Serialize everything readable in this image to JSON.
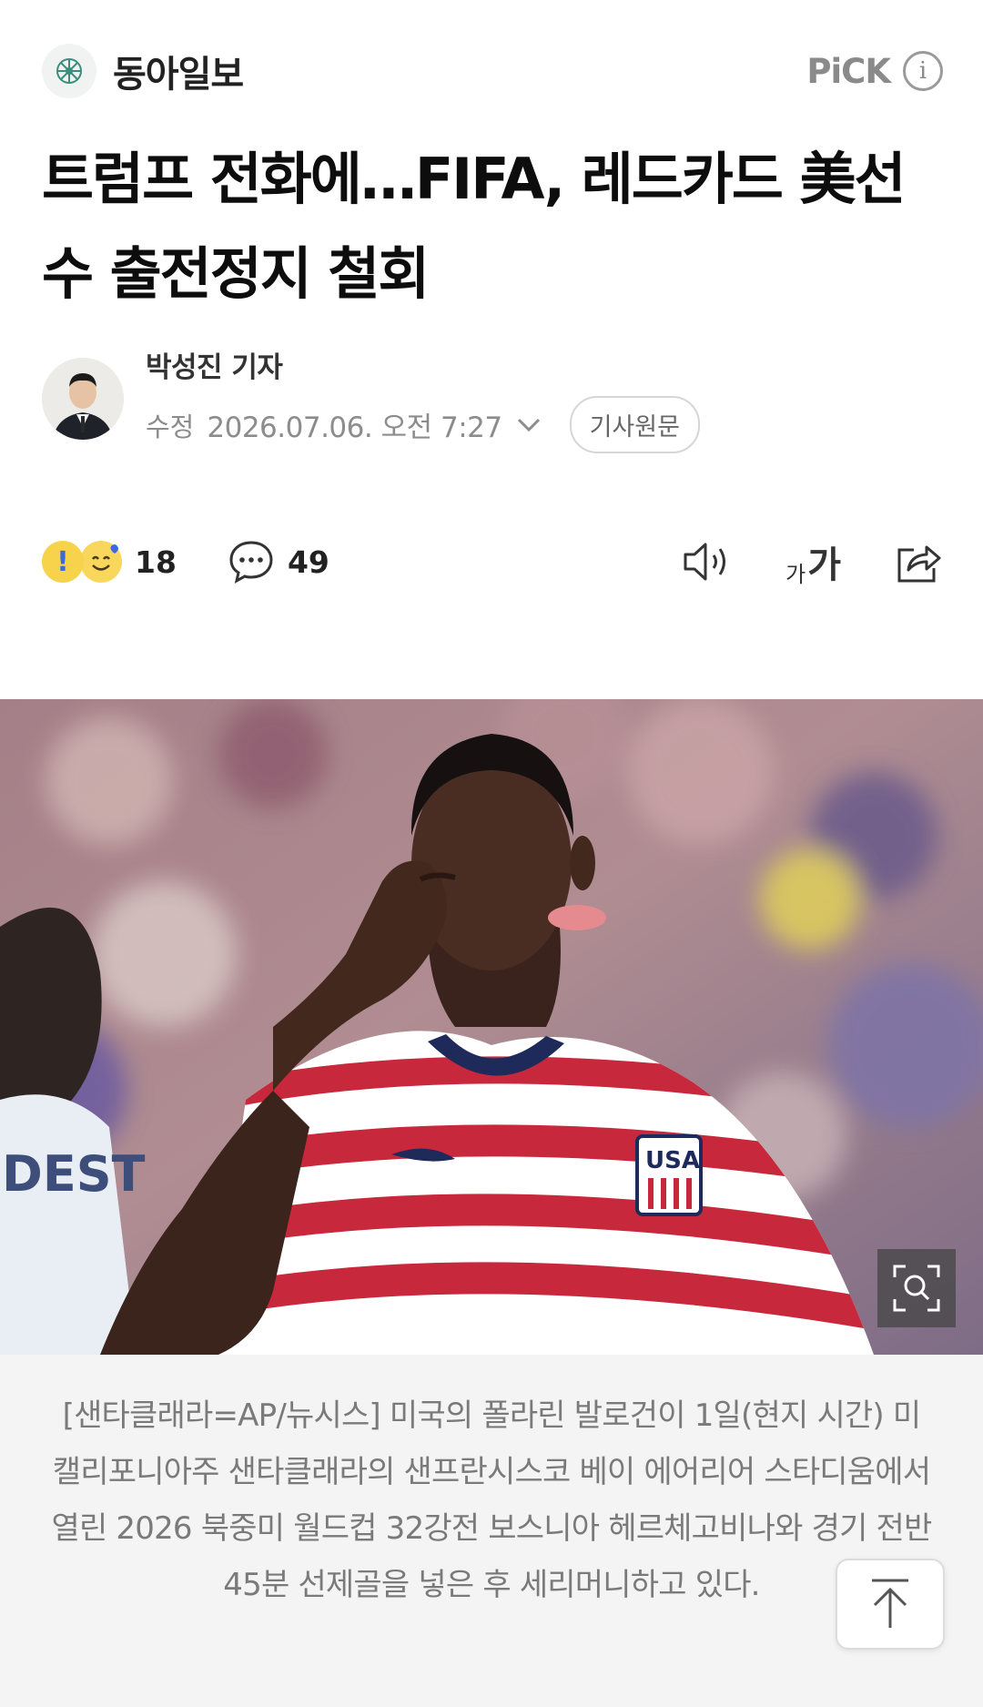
{
  "header": {
    "press_name": "동아일보",
    "pick_label": "PiCK"
  },
  "article": {
    "headline": "트럼프 전화에…FIFA, 레드카드 美선수 출전정지 철회",
    "reporter": "박성진 기자",
    "date_label": "수정",
    "date_value": "2026.07.06. 오전 7:27",
    "original_button": "기사원문"
  },
  "actions": {
    "reaction_count": "18",
    "comment_count": "49"
  },
  "icons": {
    "press_logo": "press-logo-icon",
    "info": "info-icon",
    "reporter_avatar": "avatar",
    "reaction": "reaction-emoji-icons",
    "comment": "comment-icon",
    "audio": "speaker-icon",
    "font_size": "font-size-icon",
    "share": "share-icon",
    "zoom": "zoom-icon",
    "scroll_top": "arrow-up-icon"
  },
  "photo": {
    "jersey_text": "USA",
    "back_name": "DEST"
  },
  "caption": {
    "text": "[샌타클래라=AP/뉴시스] 미국의 폴라린 발로건이 1일(현지 시간) 미 캘리포니아주 샌타클래라의 샌프란시스코 베이 에어리어 스타디움에서 열린 2026 북중미 월드컵 32강전 보스니아 헤르체고비나와 경기 전반 45분 선제골을 넣은 후 세리머니하고 있다."
  },
  "colors": {
    "accent_blue": "#3c6ad8",
    "text_gray": "#8c8c8c",
    "caption_bg": "#f4f4f4"
  }
}
